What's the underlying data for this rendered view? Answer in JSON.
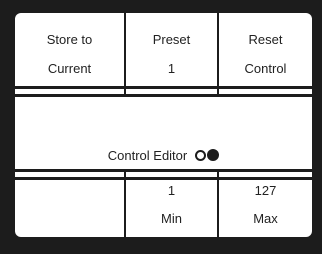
{
  "top_buttons": [
    {
      "line1": "Store to",
      "line2": "Current"
    },
    {
      "line1": "Preset",
      "line2": "1"
    },
    {
      "line1": "Reset",
      "line2": "Control"
    }
  ],
  "editor": {
    "label": "Control Editor",
    "indicators": [
      "circle-outline-icon",
      "circle-filled-icon"
    ]
  },
  "bottom_cells": [
    {
      "value": "",
      "label": ""
    },
    {
      "value": "1",
      "label": "Min"
    },
    {
      "value": "127",
      "label": "Max"
    }
  ],
  "colors": {
    "background": "#1c1c1c",
    "panel": "#ffffff",
    "text": "#222222"
  }
}
